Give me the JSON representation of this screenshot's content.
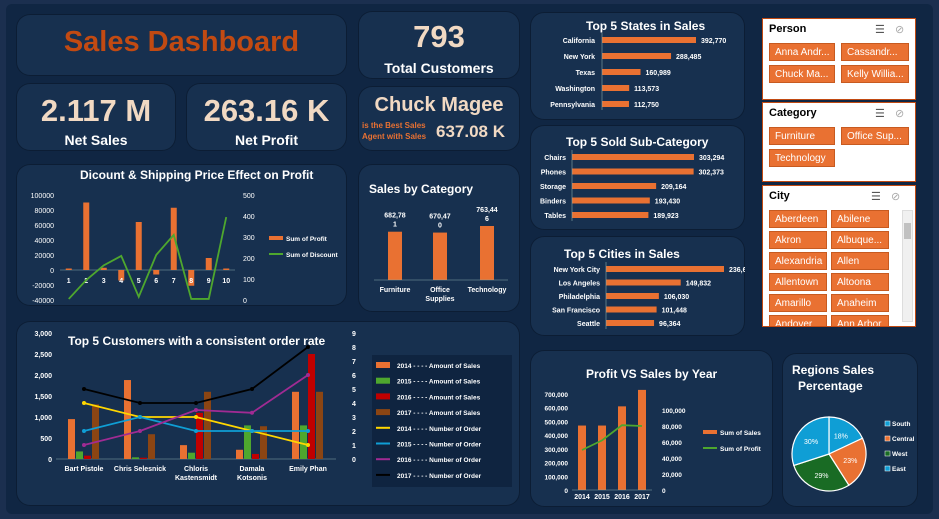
{
  "title": "Sales Dashboard",
  "kpi": {
    "customers_value": "793",
    "customers_label": "Total Customers",
    "net_sales_value": "2.117 M",
    "net_sales_label": "Net Sales",
    "net_profit_value": "263.16 K",
    "net_profit_label": "Net Profit",
    "best_agent_name": "Chuck Magee",
    "best_agent_caption_1": "is the Best Sales",
    "best_agent_caption_2": "Agent with Sales",
    "best_agent_value": "637.08 K"
  },
  "colors": {
    "orange": "#e97132",
    "green": "#4ea72e",
    "blue": "#0f9ed5",
    "purple": "#a02b93",
    "darkred": "#c00000",
    "brown": "#8b4513",
    "black": "#000000",
    "yellow": "#ffd700"
  },
  "slicers": {
    "person": {
      "header": "Person",
      "items": [
        "Anna Andr...",
        "Cassandr...",
        "Chuck Ma...",
        "Kelly Willia..."
      ]
    },
    "category": {
      "header": "Category",
      "items": [
        "Furniture",
        "Office Sup...",
        "Technology"
      ]
    },
    "city": {
      "header": "City",
      "items": [
        "Aberdeen",
        "Abilene",
        "Akron",
        "Albuque...",
        "Alexandria",
        "Allen",
        "Allentown",
        "Altoona",
        "Amarillo",
        "Anaheim",
        "Andover",
        "Ann Arbor"
      ]
    }
  },
  "chart_data": [
    {
      "id": "states",
      "type": "bar",
      "title": "Top 5 States in Sales",
      "categories": [
        "California",
        "New York",
        "Texas",
        "Washington",
        "Pennsylvania"
      ],
      "values": [
        392770,
        288485,
        160989,
        113573,
        112750
      ],
      "labels": [
        "392,770",
        "288,485",
        "160,989",
        "113,573",
        "112,750"
      ]
    },
    {
      "id": "subcat",
      "type": "bar",
      "title": "Top 5 Sold Sub-Category",
      "categories": [
        "Chairs",
        "Phones",
        "Storage",
        "Binders",
        "Tables"
      ],
      "values": [
        303294,
        302373,
        209164,
        193430,
        189923
      ],
      "labels": [
        "303,294",
        "302,373",
        "209,164",
        "193,430",
        "189,923"
      ]
    },
    {
      "id": "cities",
      "type": "bar",
      "title": "Top 5 Cities in Sales",
      "categories": [
        "New York City",
        "Los Angeles",
        "Philadelphia",
        "San Francisco",
        "Seattle"
      ],
      "values": [
        236646,
        149832,
        106030,
        101448,
        96364
      ],
      "labels": [
        "236,646",
        "149,832",
        "106,030",
        "101,448",
        "96,364"
      ]
    },
    {
      "id": "category",
      "type": "bar",
      "title": "Sales by Category",
      "categories": [
        "Furniture",
        "Office Supplies",
        "Technology"
      ],
      "values": [
        682781,
        670470,
        763446
      ],
      "labels": [
        [
          "682,78",
          "1"
        ],
        [
          "670,47",
          "0"
        ],
        [
          "763,44",
          "6"
        ]
      ],
      "xlabels": [
        [
          "Furniture"
        ],
        [
          "Office",
          "Supplies"
        ],
        [
          "Technology"
        ]
      ]
    },
    {
      "id": "discount",
      "type": "bar",
      "title": "Dicount & Shipping Price Effect on Profit",
      "categories": [
        "1",
        "2",
        "3",
        "4",
        "5",
        "6",
        "7",
        "8",
        "9",
        "10"
      ],
      "series": [
        {
          "name": "Sum of Profit",
          "type": "bar",
          "values": [
            2000,
            90000,
            3000,
            -14000,
            64000,
            -6000,
            83000,
            -21000,
            16000,
            2000
          ]
        },
        {
          "name": "Sum of Discount",
          "type": "line",
          "values": [
            5,
            95,
            165,
            210,
            15,
            215,
            310,
            5,
            5,
            395
          ]
        }
      ],
      "ylim": [
        -40000,
        100000
      ],
      "y2lim": [
        0,
        500
      ],
      "yticks": [
        "100000",
        "80000",
        "60000",
        "40000",
        "20000",
        "0",
        "-20000",
        "-40000"
      ],
      "y2ticks": [
        "500",
        "400",
        "300",
        "200",
        "100",
        "0"
      ]
    },
    {
      "id": "customers",
      "type": "bar",
      "title": "Top 5 Customers with a consistent order rate",
      "categories": [
        "Bart Pistole",
        "Chris Selesnick",
        "Chloris Kastensmidt",
        "Damala Kotsonis",
        "Emily Phan"
      ],
      "xlabels": [
        [
          "Bart Pistole"
        ],
        [
          "Chris Selesnick"
        ],
        [
          "Chloris",
          "Kastensmidt"
        ],
        [
          "Damala",
          "Kotsonis"
        ],
        [
          "Emily Phan"
        ]
      ],
      "series": [
        {
          "name": "2014 - - - - Amount of Sales",
          "type": "bar",
          "values": [
            950,
            1880,
            330,
            220,
            1600
          ]
        },
        {
          "name": "2015 - - - - Amount of Sales",
          "type": "bar",
          "values": [
            180,
            40,
            150,
            800,
            800
          ]
        },
        {
          "name": "2016 - - - - Amount of Sales",
          "type": "bar",
          "values": [
            80,
            30,
            1100,
            120,
            2500
          ]
        },
        {
          "name": "2017 - - - - Amount of Sales",
          "type": "bar",
          "values": [
            1300,
            590,
            1600,
            780,
            1600
          ]
        },
        {
          "name": "2014 - - - - Number of Order",
          "type": "line",
          "values": [
            4,
            3,
            3,
            2,
            1
          ]
        },
        {
          "name": "2015 - - - - Number of Order",
          "type": "line",
          "values": [
            2,
            3,
            2,
            2,
            2
          ]
        },
        {
          "name": "2016 - - - - Number of Order",
          "type": "line",
          "values": [
            1,
            2,
            3.5,
            3.3,
            6
          ]
        },
        {
          "name": "2017 - - - - Number of Order",
          "type": "line",
          "values": [
            5,
            4,
            4,
            5,
            8
          ]
        }
      ],
      "ylim": [
        0,
        3000
      ],
      "y2lim": [
        0,
        9
      ],
      "yticks": [
        "3,000",
        "2,500",
        "2,000",
        "1,500",
        "1,000",
        "500",
        "0"
      ],
      "y2ticks": [
        "9",
        "8",
        "7",
        "6",
        "5",
        "4",
        "3",
        "2",
        "1",
        "0"
      ]
    },
    {
      "id": "pvs",
      "type": "bar",
      "title": "Profit VS Sales by Year",
      "categories": [
        "2014",
        "2015",
        "2016",
        "2017"
      ],
      "series": [
        {
          "name": "Sum of Sales",
          "type": "bar",
          "values": [
            470000,
            470000,
            610000,
            730000
          ]
        },
        {
          "name": "Sum of Profit",
          "type": "line",
          "values": [
            50000,
            62000,
            81000,
            80000
          ]
        }
      ],
      "ylim": [
        0,
        700000
      ],
      "y2lim": [
        0,
        100000
      ],
      "yticks": [
        "700,000",
        "600,000",
        "500,000",
        "400,000",
        "300,000",
        "200,000",
        "100,000",
        "0"
      ],
      "y2ticks": [
        "100,000",
        "80,000",
        "60,000",
        "40,000",
        "20,000",
        "0"
      ]
    },
    {
      "id": "regions",
      "type": "pie",
      "title": "Regions Sales Percentage",
      "categories": [
        "South",
        "Central",
        "West",
        "East"
      ],
      "values": [
        18,
        23,
        29,
        30
      ],
      "labels": [
        "18%",
        "23%",
        "29%",
        "30%"
      ]
    }
  ]
}
